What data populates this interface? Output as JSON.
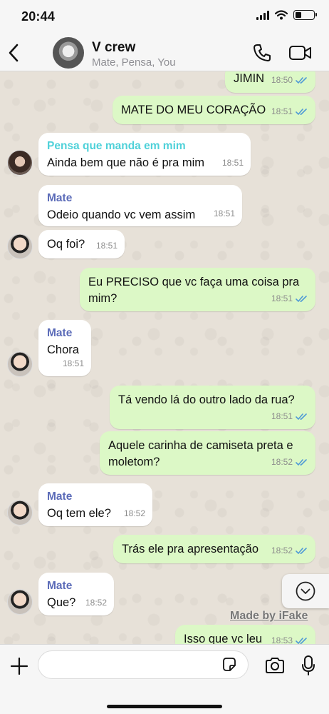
{
  "status": {
    "time": "20:44",
    "battery_level": 0.35
  },
  "header": {
    "title": "V crew",
    "subtitle": "Mate, Pensa, You"
  },
  "colors": {
    "outgoing_bubble": "#dcf8c6",
    "incoming_bubble": "#ffffff",
    "sender_mate": "#5b6bb8",
    "sender_pensa": "#4fd1d9",
    "read_ticks": "#4f9ad6"
  },
  "messages": [
    {
      "dir": "out",
      "text": "JIMIN",
      "time": "18:50",
      "ticks": "read"
    },
    {
      "dir": "out",
      "text": "MATE DO MEU CORAÇÃO",
      "time": "18:51",
      "ticks": "read"
    },
    {
      "dir": "in",
      "sender": "Pensa que manda em mim",
      "text": "Ainda bem que não é pra mim",
      "time": "18:51"
    },
    {
      "dir": "in",
      "sender": "Mate",
      "text": "Odeio quando vc vem assim",
      "time": "18:51"
    },
    {
      "dir": "in",
      "text": "Oq foi?",
      "time": "18:51"
    },
    {
      "dir": "out",
      "text_lines": [
        "Eu PRECISO que vc faça uma coisa pra",
        "mim?"
      ],
      "time": "18:51",
      "ticks": "read"
    },
    {
      "dir": "in",
      "sender": "Mate",
      "text": "Chora",
      "time": "18:51"
    },
    {
      "dir": "out",
      "text": "Tá vendo lá do outro lado da rua?",
      "time": "18:51",
      "ticks": "read"
    },
    {
      "dir": "out",
      "text_lines": [
        "Aquele carinha de camiseta preta e",
        "moletom?"
      ],
      "time": "18:52",
      "ticks": "read"
    },
    {
      "dir": "in",
      "sender": "Mate",
      "text": "Oq tem ele?",
      "time": "18:52"
    },
    {
      "dir": "out",
      "text": "Trás ele pra apresentação",
      "time": "18:52",
      "ticks": "read"
    },
    {
      "dir": "in",
      "sender": "Mate",
      "text": "Que?",
      "time": "18:52"
    },
    {
      "dir": "out",
      "text": "Isso que vc leu",
      "time": "18:53",
      "ticks": "read"
    }
  ],
  "watermark": "Made by iFake",
  "icons": {
    "back": "chevron-left-icon",
    "call": "phone-icon",
    "video": "video-camera-icon",
    "scroll_down": "chevron-down-circle-icon",
    "attach": "plus-icon",
    "sticker": "sticker-icon",
    "camera": "camera-icon",
    "mic": "microphone-icon"
  }
}
